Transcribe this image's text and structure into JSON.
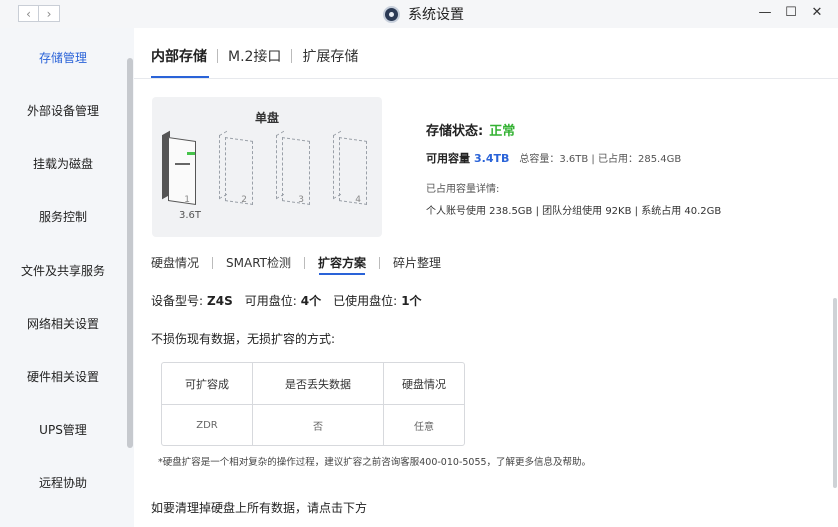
{
  "window": {
    "title": "系统设置",
    "back": "‹",
    "forward": "›",
    "min": "—",
    "max": "☐",
    "close": "✕"
  },
  "sidebar": {
    "items": [
      {
        "label": "存储管理",
        "active": true
      },
      {
        "label": "外部设备管理"
      },
      {
        "label": "挂载为磁盘"
      },
      {
        "label": "服务控制"
      },
      {
        "label": "文件及共享服务"
      },
      {
        "label": "网络相关设置"
      },
      {
        "label": "硬件相关设置"
      },
      {
        "label": "UPS管理"
      },
      {
        "label": "远程协助"
      }
    ]
  },
  "tabs": [
    "内部存储",
    "M.2接口",
    "扩展存储"
  ],
  "disk_card": {
    "title": "单盘",
    "capacity": "3.6T",
    "slots": [
      "1",
      "2",
      "3",
      "4"
    ]
  },
  "status": {
    "label": "存储状态:",
    "value": "正常",
    "available_label": "可用容量",
    "available_value": "3.4TB",
    "usage_summary": "总容量：3.6TB | 已占用：285.4GB",
    "detail_title": "已占用容量详情:",
    "detail_line": "个人账号使用 238.5GB | 团队分组使用 92KB | 系统占用 40.2GB"
  },
  "subtabs": [
    "硬盘情况",
    "SMART检测",
    "扩容方案",
    "碎片整理"
  ],
  "device": {
    "model_label": "设备型号:",
    "model": "Z4S",
    "slots_label": "可用盘位:",
    "slots": "4个",
    "used_label": "已使用盘位:",
    "used": "1个"
  },
  "method_line": "不损伤现有数据，无损扩容的方式:",
  "table": {
    "headers": [
      "可扩容成",
      "是否丢失数据",
      "硬盘情况"
    ],
    "rows": [
      [
        "ZDR",
        "否",
        "任意"
      ]
    ]
  },
  "note": "*硬盘扩容是一个相对复杂的操作过程，建议扩容之前咨询客服400-010-5055，了解更多信息及帮助。",
  "clear_line": "如要清理掉硬盘上所有数据，请点击下方",
  "colors": {
    "accent": "#2a63d8",
    "ok": "#34b233"
  }
}
